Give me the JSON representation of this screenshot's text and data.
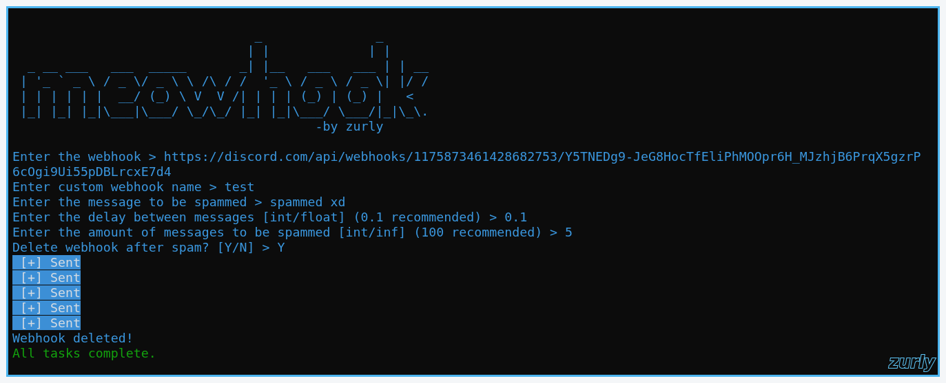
{
  "banner": {
    "art_lines": [
      "                                _               _",
      "                               | |             | |",
      "  _ __ ___   ___  _____       _| |__   ___   ___ | | __",
      " | '_ ` _ \\ / _ \\/ _ \\ \\ /\\ / /  '_ \\ / _ \\ / _ \\| |/ /",
      " | | | | | |  __/ (_) \\ V  V /| | | | (_) | (_) |   <",
      " |_| |_| |_|\\___|\\___/ \\_/\\_/ |_| |_|\\___/ \\___/|_|\\_\\.",
      "                                        -by zurly"
    ]
  },
  "lines": [
    {
      "text": "Enter the webhook > https://discord.com/api/webhooks/1175873461428682753/Y5TNEDg9-JeG8HocTfEliPhMOOpr6H_MJzhjB6PrqX5gzrP6cOgi9Ui55pDBLrcxE7d4",
      "kind": "info",
      "selected": false
    },
    {
      "text": "Enter custom webhook name > test",
      "kind": "info",
      "selected": false
    },
    {
      "text": "Enter the message to be spammed > spammed xd",
      "kind": "info",
      "selected": false
    },
    {
      "text": "Enter the delay between messages [int/float] (0.1 recommended) > 0.1",
      "kind": "info",
      "selected": false
    },
    {
      "text": "Enter the amount of messages to be spammed [int/inf] (100 recommended) > 5",
      "kind": "info",
      "selected": false
    },
    {
      "text": "Delete webhook after spam? [Y/N] > Y",
      "kind": "info",
      "selected": false
    },
    {
      "text": " [+] Sent",
      "kind": "plain",
      "selected": true
    },
    {
      "text": " [+] Sent",
      "kind": "plain",
      "selected": true
    },
    {
      "text": " [+] Sent",
      "kind": "plain",
      "selected": true
    },
    {
      "text": " [+] Sent",
      "kind": "plain",
      "selected": true
    },
    {
      "text": " [+] Sent",
      "kind": "plain",
      "selected": true
    },
    {
      "text": "Webhook deleted!",
      "kind": "info",
      "selected": false
    },
    {
      "text": "All tasks complete.",
      "kind": "success",
      "selected": false
    }
  ],
  "signature": "zurly"
}
